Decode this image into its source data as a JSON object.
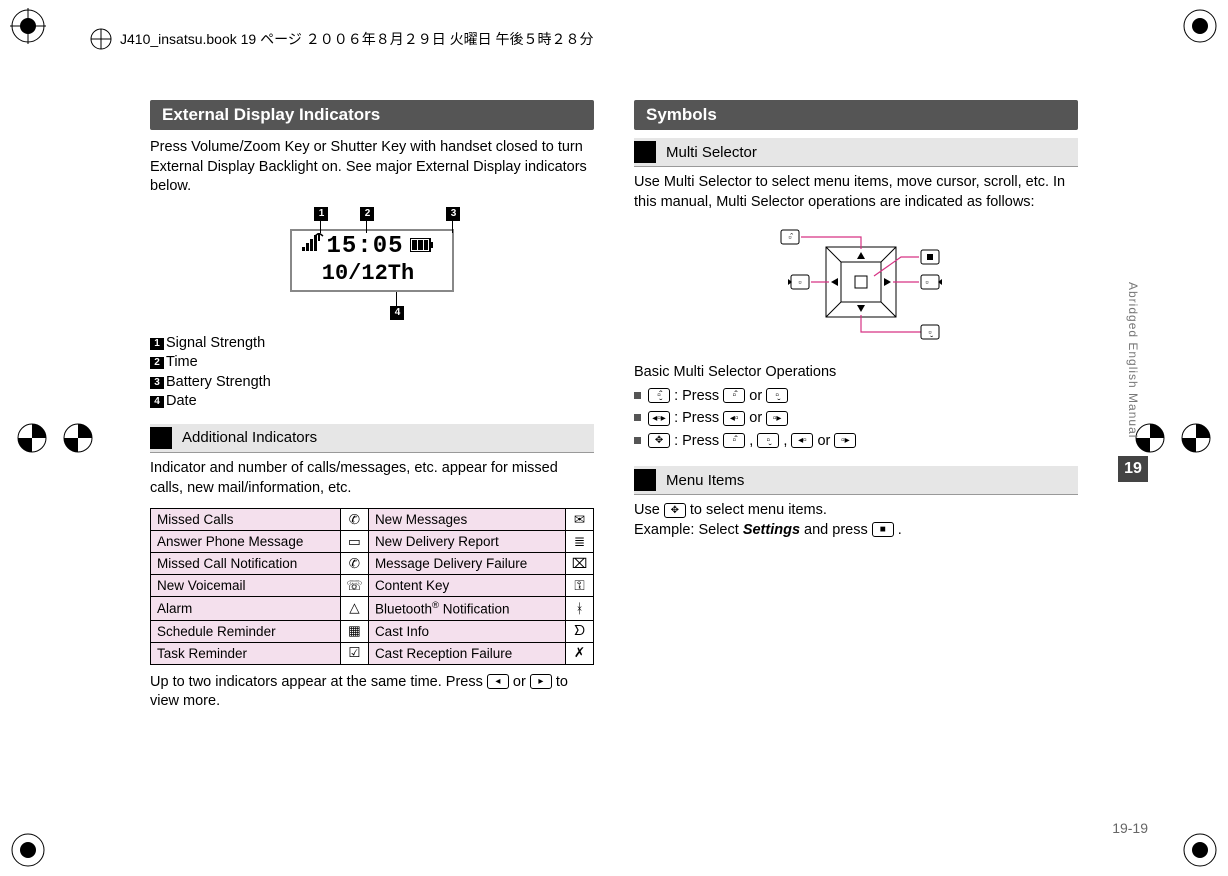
{
  "header": {
    "text": "J410_insatsu.book 19 ページ ２００６年８月２９日 火曜日 午後５時２８分"
  },
  "left": {
    "section_title": "External Display Indicators",
    "intro": "Press Volume/Zoom Key or Shutter Key with handset closed to turn External Display Backlight on. See major External Display indicators below.",
    "lcd": {
      "time": "15:05",
      "date": "10/12Th"
    },
    "callouts": {
      "c1": "1",
      "c2": "2",
      "c3": "3",
      "c4": "4"
    },
    "indicators": [
      {
        "n": "1",
        "label": "Signal Strength"
      },
      {
        "n": "2",
        "label": "Time"
      },
      {
        "n": "3",
        "label": "Battery Strength"
      },
      {
        "n": "4",
        "label": "Date"
      }
    ],
    "subhead": "Additional Indicators",
    "para2": "Indicator and number of calls/messages, etc. appear for missed calls, new mail/information, etc.",
    "table": [
      [
        "Missed Calls",
        "New Messages"
      ],
      [
        "Answer Phone Message",
        "New Delivery Report"
      ],
      [
        "Missed Call Notification",
        "Message Delivery Failure"
      ],
      [
        "New Voicemail",
        "Content Key"
      ],
      [
        "Alarm",
        "Bluetooth® Notification"
      ],
      [
        "Schedule Reminder",
        "Cast Info"
      ],
      [
        "Task Reminder",
        "Cast Reception Failure"
      ]
    ],
    "table_icons": [
      [
        "phone-missed-icon",
        "envelope-icon"
      ],
      [
        "tape-icon",
        "list-icon"
      ],
      [
        "phone-missed-icon",
        "envelope-fail-icon"
      ],
      [
        "voicemail-icon",
        "key-icon"
      ],
      [
        "bell-icon",
        "bluetooth-icon"
      ],
      [
        "calendar-icon",
        "antenna-icon"
      ],
      [
        "checkbox-icon",
        "antenna-fail-icon"
      ]
    ],
    "para3_a": "Up to two indicators appear at the same time. Press ",
    "para3_b": " or ",
    "para3_c": " to view more."
  },
  "right": {
    "section_title": "Symbols",
    "sub1": "Multi Selector",
    "para1": "Use Multi Selector to select menu items, move cursor, scroll, etc. In this manual, Multi Selector operations are indicated as follows:",
    "ops_title": "Basic Multi Selector Operations",
    "ops": {
      "line1_a": " : Press ",
      "line1_b": " or ",
      "line2_a": " : Press ",
      "line2_b": " or ",
      "line3_a": " : Press ",
      "line3_b": " , ",
      "line3_c": " , ",
      "line3_d": " or "
    },
    "sub2": "Menu Items",
    "para2_a": "Use ",
    "para2_b": " to select menu items.",
    "example_a": "Example: Select ",
    "example_item": "Settings",
    "example_b": " and press ",
    "example_c": "."
  },
  "sidebar": {
    "label": "Abridged English Manual",
    "chapter": "19"
  },
  "pagenum": "19-19"
}
